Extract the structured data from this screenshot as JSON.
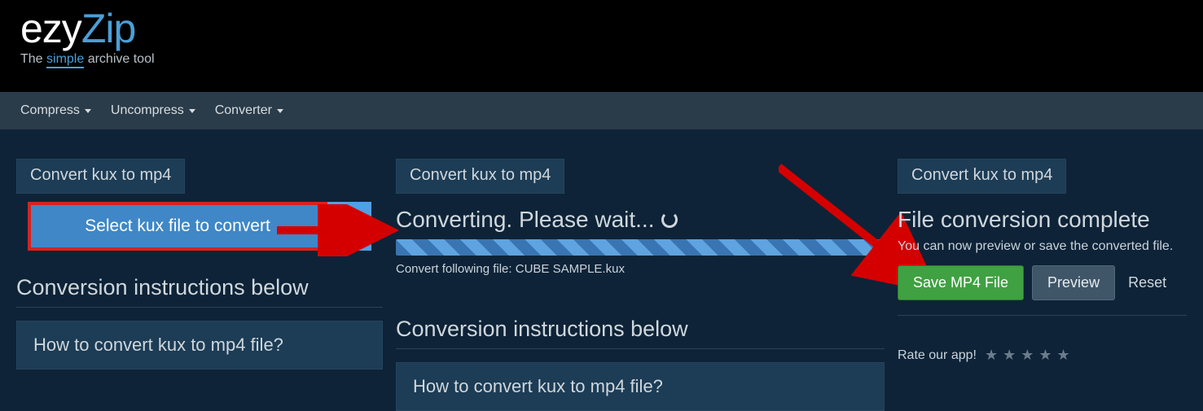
{
  "brand": {
    "part1": "ezy",
    "part2": "Zip",
    "tagline_pre": "The ",
    "tagline_highlight": "simple",
    "tagline_post": " archive tool"
  },
  "nav": {
    "compress": "Compress",
    "uncompress": "Uncompress",
    "converter": "Converter"
  },
  "col1": {
    "card_title": "Convert kux to mp4",
    "select_label": "Select kux file to convert",
    "instructions_title": "Conversion instructions below",
    "accordion": "How to convert kux to mp4 file?"
  },
  "col2": {
    "card_title": "Convert kux to mp4",
    "status": "Converting. Please wait...",
    "file_line_prefix": "Convert following file: ",
    "file_name": "CUBE SAMPLE.kux",
    "instructions_title": "Conversion instructions below",
    "accordion": "How to convert kux to mp4 file?"
  },
  "col3": {
    "card_title": "Convert kux to mp4",
    "done_title": "File conversion complete",
    "tip": "You can now preview or save the converted file.",
    "save": "Save MP4 File",
    "preview": "Preview",
    "reset": "Reset",
    "rate_label": "Rate our app!"
  }
}
